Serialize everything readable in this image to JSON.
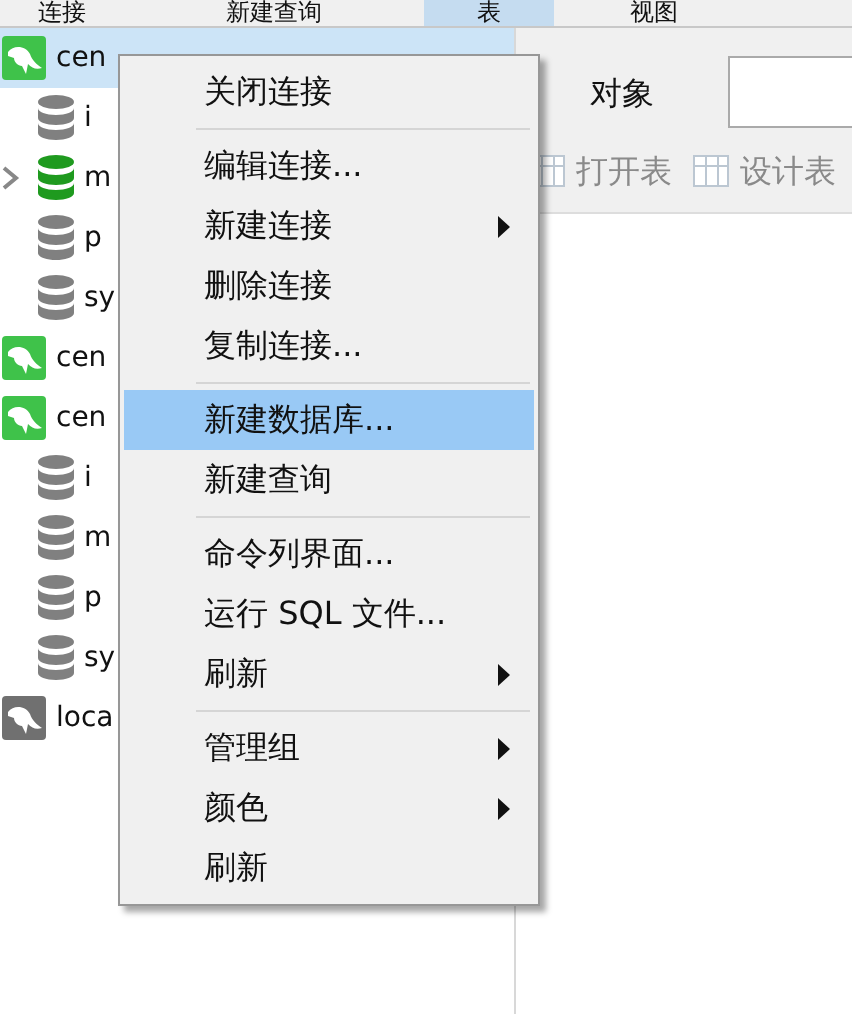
{
  "toolbar": [
    {
      "label": "连接",
      "selected": false
    },
    {
      "label": "新建查询",
      "selected": false
    },
    {
      "label": "表",
      "selected": true
    },
    {
      "label": "视图",
      "selected": false
    }
  ],
  "tree": [
    {
      "label": "cen",
      "kind": "connection",
      "color": "#3fc24a",
      "selected": true,
      "children": [
        {
          "label": "i",
          "kind": "database",
          "color": "#808080",
          "expandable": false
        },
        {
          "label": "m",
          "kind": "database",
          "color": "#1f9a1f",
          "expandable": true
        },
        {
          "label": "p",
          "kind": "database",
          "color": "#808080",
          "expandable": false
        },
        {
          "label": "sy",
          "kind": "database",
          "color": "#808080",
          "expandable": false
        }
      ]
    },
    {
      "label": "cen",
      "kind": "connection",
      "color": "#3fc24a",
      "selected": false
    },
    {
      "label": "cen",
      "kind": "connection",
      "color": "#3fc24a",
      "selected": false,
      "children": [
        {
          "label": "i",
          "kind": "database",
          "color": "#808080",
          "expandable": false
        },
        {
          "label": "m",
          "kind": "database",
          "color": "#808080",
          "expandable": false
        },
        {
          "label": "p",
          "kind": "database",
          "color": "#808080",
          "expandable": false
        },
        {
          "label": "sy",
          "kind": "database",
          "color": "#808080",
          "expandable": false
        }
      ]
    },
    {
      "label": "loca",
      "kind": "connection",
      "color": "#707070",
      "selected": false
    }
  ],
  "objects_tab": {
    "label": "对象"
  },
  "object_toolbar": [
    {
      "label": "打开表",
      "disabled": true
    },
    {
      "label": "设计表",
      "disabled": true
    }
  ],
  "context_menu": [
    {
      "kind": "item",
      "label": "关闭连接",
      "submenu": false,
      "selected": false
    },
    {
      "kind": "separator"
    },
    {
      "kind": "item",
      "label": "编辑连接...",
      "submenu": false,
      "selected": false
    },
    {
      "kind": "item",
      "label": "新建连接",
      "submenu": true,
      "selected": false
    },
    {
      "kind": "item",
      "label": "删除连接",
      "submenu": false,
      "selected": false
    },
    {
      "kind": "item",
      "label": "复制连接...",
      "submenu": false,
      "selected": false
    },
    {
      "kind": "separator"
    },
    {
      "kind": "item",
      "label": "新建数据库...",
      "submenu": false,
      "selected": true
    },
    {
      "kind": "item",
      "label": "新建查询",
      "submenu": false,
      "selected": false
    },
    {
      "kind": "separator"
    },
    {
      "kind": "item",
      "label": "命令列界面...",
      "submenu": false,
      "selected": false
    },
    {
      "kind": "item",
      "label": "运行 SQL 文件...",
      "submenu": false,
      "selected": false
    },
    {
      "kind": "item",
      "label": "刷新",
      "submenu": true,
      "selected": false
    },
    {
      "kind": "separator"
    },
    {
      "kind": "item",
      "label": "管理组",
      "submenu": true,
      "selected": false
    },
    {
      "kind": "item",
      "label": "颜色",
      "submenu": true,
      "selected": false
    },
    {
      "kind": "item",
      "label": "刷新",
      "submenu": false,
      "selected": false
    }
  ]
}
